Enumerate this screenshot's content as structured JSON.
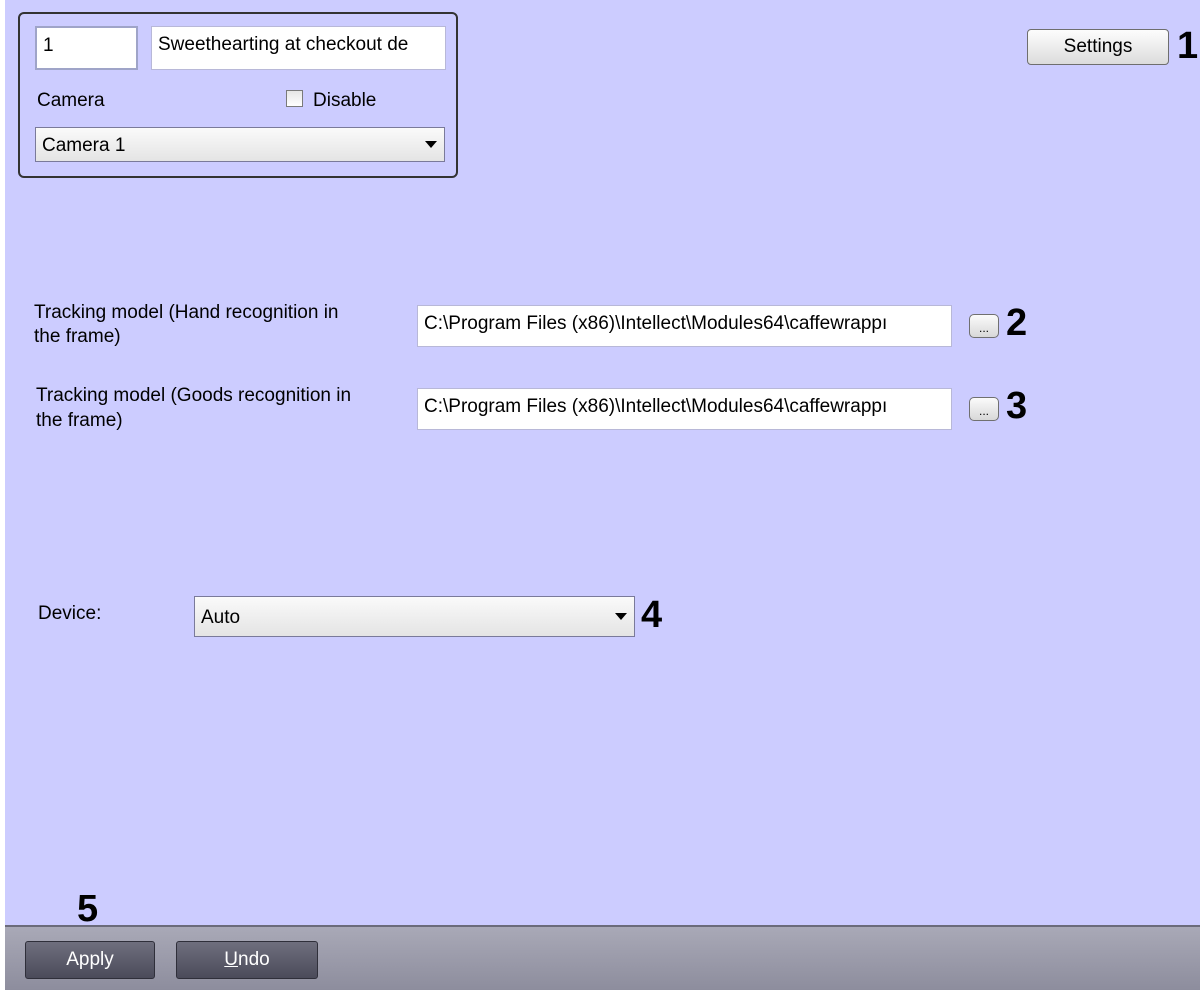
{
  "object": {
    "id_value": "1",
    "name_value": "Sweethearting at checkout de",
    "camera_label": "Camera",
    "disable_label": "Disable",
    "disable_checked": false,
    "camera_select_value": "Camera 1"
  },
  "settings_button_label": "Settings",
  "tracking_hand": {
    "label_line1": "Tracking model (Hand recognition in",
    "label_line2": "the frame)",
    "path_value": "C:\\Program Files (x86)\\Intellect\\Modules64\\caffewrappı",
    "browse_label": "..."
  },
  "tracking_goods": {
    "label_line1": "Tracking model (Goods recognition in",
    "label_line2": "the frame)",
    "path_value": "C:\\Program Files (x86)\\Intellect\\Modules64\\caffewrappı",
    "browse_label": "..."
  },
  "device": {
    "label": "Device:",
    "select_value": "Auto"
  },
  "callouts": [
    "1",
    "2",
    "3",
    "4",
    "5"
  ],
  "footer": {
    "apply_label": "Apply",
    "undo_mnemonic": "U",
    "undo_rest": "ndo"
  },
  "icons": {
    "dropdown_arrow": "chevron-down-icon",
    "checkbox": "checkbox-icon"
  },
  "colors": {
    "panel_background": "#ccccff",
    "bottom_bar": "#9a9aa8",
    "dark_button": "#5a5a68"
  }
}
